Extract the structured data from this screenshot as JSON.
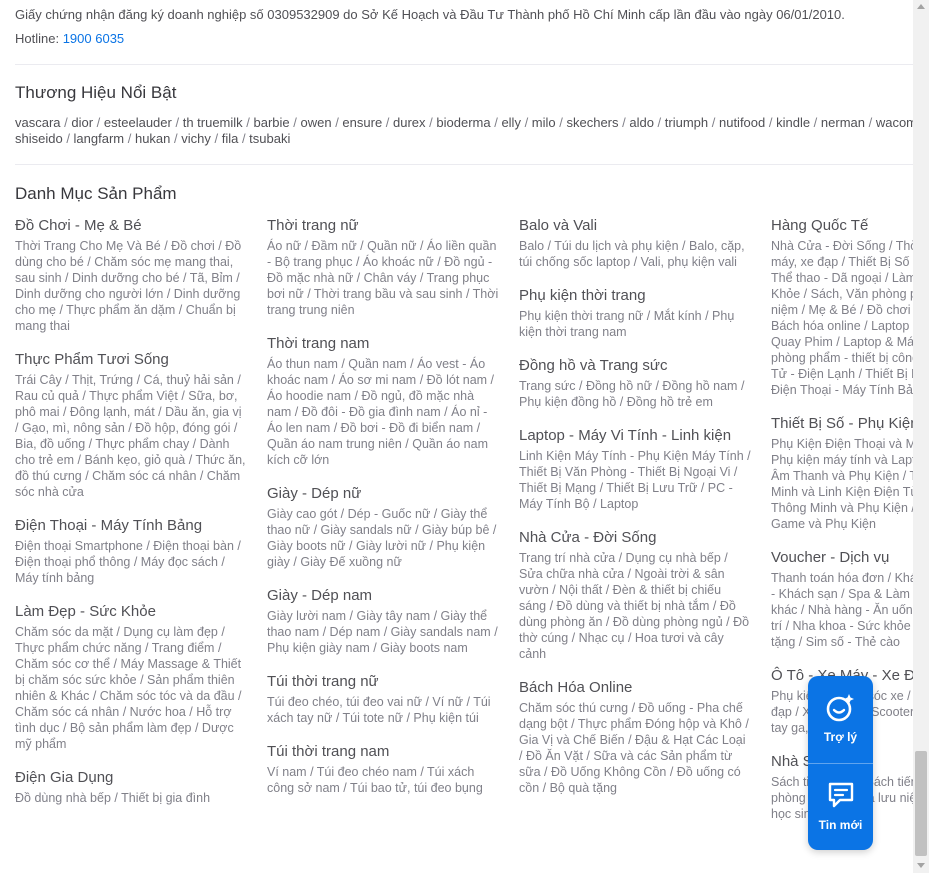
{
  "footer": {
    "business_cert": "Giấy chứng nhận đăng ký doanh nghiệp số 0309532909 do Sở Kế Hoạch và Đầu Tư Thành phố Hồ Chí Minh cấp lần đầu vào ngày 06/01/2010.",
    "hotline_label": "Hotline:",
    "hotline_number": "1900 6035"
  },
  "brands": {
    "title": "Thương Hiệu Nổi Bật",
    "items": [
      "vascara",
      "dior",
      "esteelauder",
      "th truemilk",
      "barbie",
      "owen",
      "ensure",
      "durex",
      "bioderma",
      "elly",
      "milo",
      "skechers",
      "aldo",
      "triumph",
      "nutifood",
      "kindle",
      "nerman",
      "wacom",
      "shiseido",
      "langfarm",
      "hukan",
      "vichy",
      "fila",
      "tsubaki"
    ]
  },
  "categories": {
    "title": "Danh Mục Sản Phẩm",
    "columns": [
      [
        {
          "title": "Đồ Chơi - Mẹ & Bé",
          "links": "Thời Trang Cho Mẹ Và Bé / Đồ chơi / Đồ dùng cho bé / Chăm sóc mẹ mang thai, sau sinh / Dinh dưỡng cho bé / Tã, Bỉm / Dinh dưỡng cho người lớn / Dinh dưỡng cho mẹ / Thực phẩm ăn dặm / Chuẩn bị mang thai"
        },
        {
          "title": "Thực Phẩm Tươi Sống",
          "links": "Trái Cây / Thịt, Trứng / Cá, thuỷ hải sản / Rau củ quả / Thực phẩm Việt / Sữa, bơ, phô mai / Đông lạnh, mát / Dầu ăn, gia vị / Gạo, mì, nông sản / Đồ hộp, đóng gói / Bia, đồ uống / Thực phẩm chay / Dành cho trẻ em / Bánh kẹo, giỏ quà / Thức ăn, đồ thú cưng / Chăm sóc cá nhân / Chăm sóc nhà cửa"
        },
        {
          "title": "Điện Thoại - Máy Tính Bảng",
          "links": "Điện thoại Smartphone / Điện thoại bàn / Điện thoại phổ thông / Máy đọc sách / Máy tính bảng"
        },
        {
          "title": "Làm Đẹp - Sức Khỏe",
          "links": "Chăm sóc da mặt / Dụng cụ làm đẹp / Thực phẩm chức năng / Trang điểm / Chăm sóc cơ thể / Máy Massage & Thiết bị chăm sóc sức khỏe / Sản phẩm thiên nhiên & Khác / Chăm sóc tóc và da đầu / Chăm sóc cá nhân / Nước hoa / Hỗ trợ tình dục / Bộ sản phẩm làm đẹp / Dược mỹ phẩm"
        },
        {
          "title": "Điện Gia Dụng",
          "links": "Đồ dùng nhà bếp / Thiết bị gia đình"
        }
      ],
      [
        {
          "title": "Thời trang nữ",
          "links": "Áo nữ / Đầm nữ / Quần nữ / Áo liền quần - Bộ trang phục / Áo khoác nữ / Đồ ngủ - Đồ mặc nhà nữ / Chân váy / Trang phục bơi nữ / Thời trang bầu và sau sinh / Thời trang trung niên"
        },
        {
          "title": "Thời trang nam",
          "links": "Áo thun nam / Quần nam / Áo vest - Áo khoác nam / Áo sơ mi nam / Đồ lót nam / Áo hoodie nam / Đồ ngủ, đồ mặc nhà nam / Đồ đôi - Đồ gia đình nam / Áo nỉ - Áo len nam / Đồ bơi - Đồ đi biển nam / Quần áo nam trung niên / Quần áo nam kích cỡ lớn"
        },
        {
          "title": "Giày - Dép nữ",
          "links": "Giày cao gót / Dép - Guốc nữ / Giày thể thao nữ / Giày sandals nữ / Giày búp bê / Giày boots nữ / Giày lười nữ / Phụ kiện giày / Giày Đế xuồng nữ"
        },
        {
          "title": "Giày - Dép nam",
          "links": "Giày lười nam / Giày tây nam / Giày thể thao nam / Dép nam / Giày sandals nam / Phụ kiện giày nam / Giày boots nam"
        },
        {
          "title": "Túi thời trang nữ",
          "links": "Túi đeo chéo, túi đeo vai nữ / Ví nữ / Túi xách tay nữ / Túi tote nữ / Phụ kiện túi"
        },
        {
          "title": "Túi thời trang nam",
          "links": "Ví nam / Túi đeo chéo nam / Túi xách công sở nam / Túi bao tử, túi đeo bụng"
        }
      ],
      [
        {
          "title": "Balo và Vali",
          "links": "Balo / Túi du lịch và phụ kiện / Balo, cặp, túi chống sốc laptop / Vali, phụ kiện vali"
        },
        {
          "title": "Phụ kiện thời trang",
          "links": "Phụ kiện thời trang nữ / Mắt kính / Phụ kiện thời trang nam"
        },
        {
          "title": "Đồng hồ và Trang sức",
          "links": "Trang sức / Đồng hồ nữ / Đồng hồ nam / Phụ kiện đồng hồ / Đồng hồ trẻ em"
        },
        {
          "title": "Laptop - Máy Vi Tính - Linh kiện",
          "links": "Linh Kiện Máy Tính - Phụ Kiện Máy Tính / Thiết Bị Văn Phòng - Thiết Bị Ngoại Vi / Thiết Bị Mạng / Thiết Bị Lưu Trữ / PC - Máy Tính Bộ / Laptop"
        },
        {
          "title": "Nhà Cửa - Đời Sống",
          "links": "Trang trí nhà cửa / Dụng cụ nhà bếp / Sửa chữa nhà cửa / Ngoài trời & sân vườn / Nội thất / Đèn & thiết bị chiếu sáng / Đồ dùng và thiết bị nhà tắm / Đồ dùng phòng ăn / Đồ dùng phòng ngủ / Đồ thờ cúng / Nhạc cụ / Hoa tươi và cây cảnh"
        },
        {
          "title": "Bách Hóa Online",
          "links": "Chăm sóc thú cưng / Đồ uống - Pha chế dạng bột / Thực phẩm Đóng hộp và Khô / Gia Vị và Chế Biến / Đậu & Hạt Các Loại / Đồ Ăn Vặt / Sữa và các Sản phẩm từ sữa / Đồ Uống Không Cồn / Đồ uống có cồn / Bộ quà tặng"
        }
      ],
      [
        {
          "title": "Hàng Quốc Tế",
          "links": "Nhà Cửa - Đời Sống / Thời trang / Xe máy, xe đạp / Thiết Bị Số - Phụ Kiện Số / Thể thao - Dã ngoại / Làm Đẹp - Sức Khỏe / Sách, Văn phòng phẩm - Quà lưu niệm / Mẹ & Bé / Đồ chơi / Đồ dùng / Bách hóa online / Laptop - Máy Vi Tính / Quay Phim / Laptop & Máy tính / Văn phòng phẩm - thiết bị công nghiệp / Điện Tử - Điện Lạnh / Thiết Bị Nghe Nhìn / Điện Thoại - Máy Tính Bảng"
        },
        {
          "title": "Thiết Bị Số - Phụ Kiện Số",
          "links": "Phụ Kiện Điện Thoại và Máy Tính Bảng / Phụ kiện máy tính và Laptop / Thiết Bị Âm Thanh và Phụ Kiện / Thiết Bị Thông Minh và Linh Kiện Điện Tử / Thiết Bị Đeo Thông Minh và Phụ Kiện / Thiết Bị Chơi Game và Phụ Kiện"
        },
        {
          "title": "Voucher - Dịch vụ",
          "links": "Thanh toán hóa đơn / Khách sạn, Resort - Khách sạn / Spa & Làm đẹp / Dịch vụ khác / Nhà hàng - Ăn uống / Du lịch / Giải trí / Nha khoa - Sức khỏe / Phiếu quà tặng / Sim số - Thẻ cào"
        },
        {
          "title": "Ô Tô - Xe Máy - Xe Đạp",
          "links": "Phụ kiện - Chăm sóc xe / Xe máy / Xe đạp / Xe ô tô / Xe Scooter / Xe điện / Xe tay ga, xe côn"
        },
        {
          "title": "Nhà Sách Tiki",
          "links": "Sách tiếng Anh / Sách tiếng Việt / Văn phòng phẩm / Quà lưu niệm / Đồ dùng học sinh / Books"
        }
      ]
    ]
  },
  "assistant": {
    "assistant_label": "Trợ lý",
    "messages_label": "Tin mới"
  }
}
